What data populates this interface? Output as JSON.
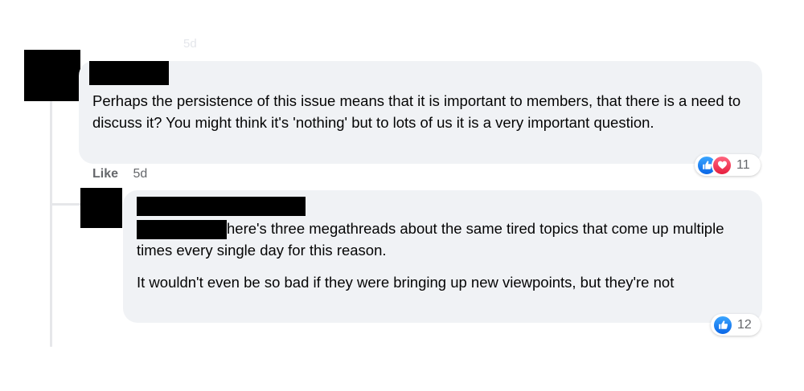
{
  "ghost_text": "5d",
  "comments": [
    {
      "text": "Perhaps the persistence of this issue means that it is important to members, that there is a need to discuss it? You might think it's 'nothing' but to lots of us it is a very important question.",
      "actions": {
        "like_label": "Like",
        "time": "5d"
      },
      "reactions": {
        "icons": [
          "like-icon",
          "love-icon"
        ],
        "count": "11"
      }
    },
    {
      "paragraphs": [
        "here's three megathreads about the same tired topics that come up multiple times every single day for this reason.",
        "It wouldn't even be so bad if they were bringing up new viewpoints, but they're not"
      ],
      "reactions": {
        "icons": [
          "like-icon"
        ],
        "count": "12"
      }
    }
  ],
  "colors": {
    "bubble_bg": "#f0f2f5",
    "text": "#050505",
    "secondary_text": "#65676b",
    "like_blue": "#1877f2",
    "love_red": "#f33e58",
    "redaction": "#000000"
  }
}
